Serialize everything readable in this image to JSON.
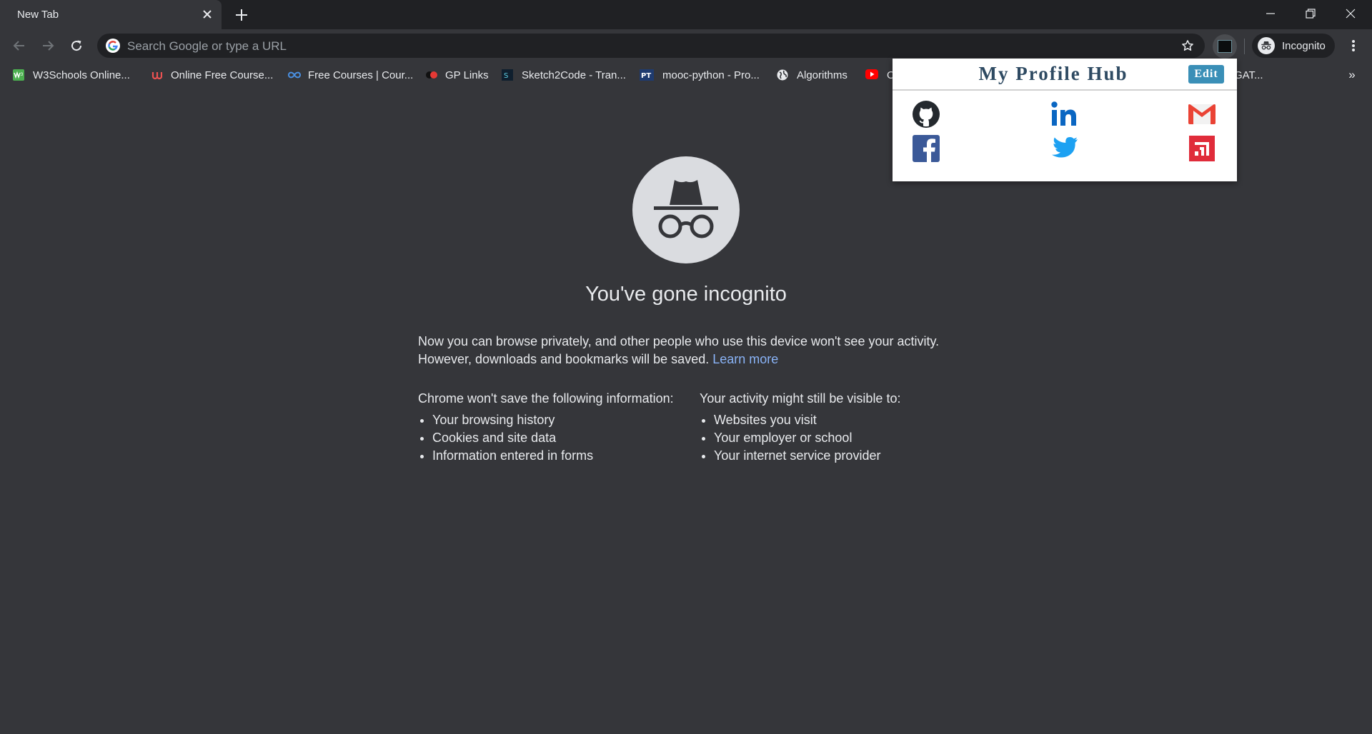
{
  "tab": {
    "title": "New Tab"
  },
  "omnibox": {
    "placeholder": "Search Google or type a URL"
  },
  "profile": {
    "label": "Incognito"
  },
  "bookmarks": [
    {
      "label": "W3Schools Online...",
      "icon": "w3schools-icon",
      "color": "#4caf50"
    },
    {
      "label": "Online Free Course...",
      "icon": "udemy-icon",
      "color": "#ec5252"
    },
    {
      "label": "Free Courses | Cour...",
      "icon": "infinity-icon",
      "color": "#4a90e2"
    },
    {
      "label": "GP Links",
      "icon": "gplinks-icon",
      "color": "#e53935"
    },
    {
      "label": "Sketch2Code - Tran...",
      "icon": "sketch2code-icon",
      "color": "#0f1f2e"
    },
    {
      "label": "mooc-python - Pro...",
      "icon": "pt-icon",
      "color": "#1f3b6f"
    },
    {
      "label": "Algorithms",
      "icon": "globe-icon",
      "color": "#e8eaed"
    },
    {
      "label": "O",
      "icon": "youtube-icon",
      "color": "#ff0000"
    },
    {
      "label": "GAT...",
      "icon": "",
      "color": ""
    }
  ],
  "ntp": {
    "title": "You've gone incognito",
    "intro_line1": "Now you can browse privately, and other people who use this device won't see your activity.",
    "intro_line2": "However, downloads and bookmarks will be saved.",
    "learn_more": "Learn more",
    "left_heading": "Chrome won't save the following information:",
    "left_items": [
      "Your browsing history",
      "Cookies and site data",
      "Information entered in forms"
    ],
    "right_heading_pre": "Your activity ",
    "right_heading_bold": "might still be visible",
    "right_heading_post": " to:",
    "right_items": [
      "Websites you visit",
      "Your employer or school",
      "Your internet service provider"
    ]
  },
  "popup": {
    "title": "My Profile Hub",
    "edit_label": "Edit",
    "links": [
      "github-icon",
      "linkedin-icon",
      "gmail-icon",
      "facebook-icon",
      "twitter-icon",
      "portfolio-icon"
    ]
  },
  "colors": {
    "page_bg": "#35363a",
    "tabstrip_bg": "#202124",
    "link": "#8ab4f8",
    "edit_button": "#3a8fb7",
    "popup_title": "#2e4a62"
  }
}
